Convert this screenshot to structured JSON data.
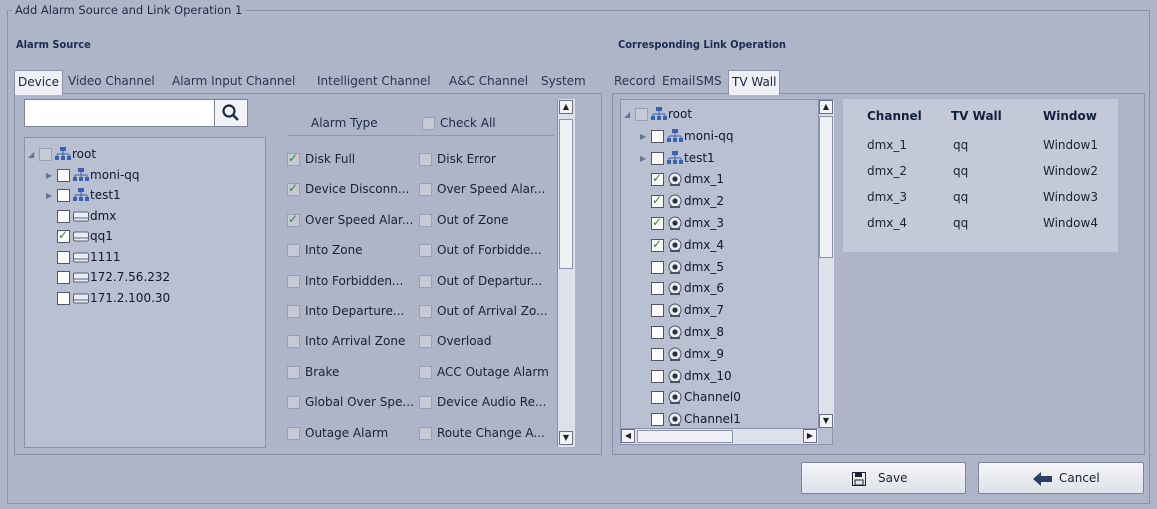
{
  "dialog": {
    "title": "Add Alarm Source and Link Operation 1"
  },
  "alarm_source": {
    "heading": "Alarm Source",
    "tabs": [
      "Device",
      "Video Channel",
      "Alarm Input Channel",
      "Intelligent Channel",
      "A&C Channel",
      "System"
    ],
    "active_tab": "Device",
    "search": {
      "value": "",
      "placeholder": ""
    },
    "tree": [
      {
        "label": "root",
        "level": 0,
        "type": "group",
        "check": "partial",
        "expander": true
      },
      {
        "label": "moni-qq",
        "level": 1,
        "type": "group",
        "check": "off",
        "expander": true
      },
      {
        "label": "test1",
        "level": 1,
        "type": "group",
        "check": "off",
        "expander": true
      },
      {
        "label": "dmx",
        "level": 1,
        "type": "device",
        "check": "off",
        "expander": false
      },
      {
        "label": "qq1",
        "level": 1,
        "type": "device",
        "check": "on",
        "expander": false
      },
      {
        "label": "1111",
        "level": 1,
        "type": "device",
        "check": "off",
        "expander": false
      },
      {
        "label": "172.7.56.232",
        "level": 1,
        "type": "device",
        "check": "off",
        "expander": false
      },
      {
        "label": "171.2.100.30",
        "level": 1,
        "type": "device",
        "check": "off",
        "expander": false
      }
    ],
    "alarm_type_label": "Alarm Type",
    "check_all_label": "Check All",
    "alarm_types": [
      [
        "Disk Full",
        true,
        "Disk Error",
        false
      ],
      [
        "Device Disconn...",
        true,
        "Over Speed Alar...",
        false
      ],
      [
        "Over Speed Alar...",
        true,
        "Out of Zone",
        false
      ],
      [
        "Into Zone",
        false,
        "Out of Forbidde...",
        false
      ],
      [
        "Into Forbidden...",
        false,
        "Out of Departur...",
        false
      ],
      [
        "Into Departure...",
        false,
        "Out of Arrival Zo...",
        false
      ],
      [
        "Into Arrival Zone",
        false,
        "Overload",
        false
      ],
      [
        "Brake",
        false,
        "ACC Outage Alarm",
        false
      ],
      [
        "Global Over Spe...",
        false,
        "Device Audio Re...",
        false
      ],
      [
        "Outage Alarm",
        false,
        "Route Change A...",
        false
      ]
    ]
  },
  "link_operation": {
    "heading": "Corresponding Link Operation",
    "tabs": [
      "Record",
      "Email",
      "SMS",
      "TV Wall"
    ],
    "active_tab": "TV Wall",
    "tree": [
      {
        "label": "root",
        "level": 0,
        "type": "group",
        "check": "partial",
        "expander": true
      },
      {
        "label": "moni-qq",
        "level": 1,
        "type": "group",
        "check": "off",
        "expander": true
      },
      {
        "label": "test1",
        "level": 1,
        "type": "group",
        "check": "off",
        "expander": true
      },
      {
        "label": "dmx_1",
        "level": 1,
        "type": "camera",
        "check": "on",
        "expander": false
      },
      {
        "label": "dmx_2",
        "level": 1,
        "type": "camera",
        "check": "on",
        "expander": false
      },
      {
        "label": "dmx_3",
        "level": 1,
        "type": "camera",
        "check": "on",
        "expander": false
      },
      {
        "label": "dmx_4",
        "level": 1,
        "type": "camera",
        "check": "on",
        "expander": false
      },
      {
        "label": "dmx_5",
        "level": 1,
        "type": "camera",
        "check": "off",
        "expander": false
      },
      {
        "label": "dmx_6",
        "level": 1,
        "type": "camera",
        "check": "off",
        "expander": false
      },
      {
        "label": "dmx_7",
        "level": 1,
        "type": "camera",
        "check": "off",
        "expander": false
      },
      {
        "label": "dmx_8",
        "level": 1,
        "type": "camera",
        "check": "off",
        "expander": false
      },
      {
        "label": "dmx_9",
        "level": 1,
        "type": "camera",
        "check": "off",
        "expander": false
      },
      {
        "label": "dmx_10",
        "level": 1,
        "type": "camera",
        "check": "off",
        "expander": false
      },
      {
        "label": "Channel0",
        "level": 1,
        "type": "camera",
        "check": "off",
        "expander": false
      },
      {
        "label": "Channel1",
        "level": 1,
        "type": "camera",
        "check": "off",
        "expander": false
      }
    ],
    "table": {
      "columns": [
        "Channel",
        "TV Wall",
        "Window"
      ],
      "rows": [
        [
          "dmx_1",
          "qq",
          "Window1"
        ],
        [
          "dmx_2",
          "qq",
          "Window2"
        ],
        [
          "dmx_3",
          "qq",
          "Window3"
        ],
        [
          "dmx_4",
          "qq",
          "Window4"
        ]
      ]
    }
  },
  "buttons": {
    "save": "Save",
    "cancel": "Cancel"
  },
  "icons": {
    "save": "floppy-disk-icon",
    "cancel": "back-arrow-icon",
    "search": "search-icon"
  },
  "colors": {
    "background": "#aeb5c9",
    "panel": "#b9c0d1",
    "check": "#2a8a2a"
  }
}
